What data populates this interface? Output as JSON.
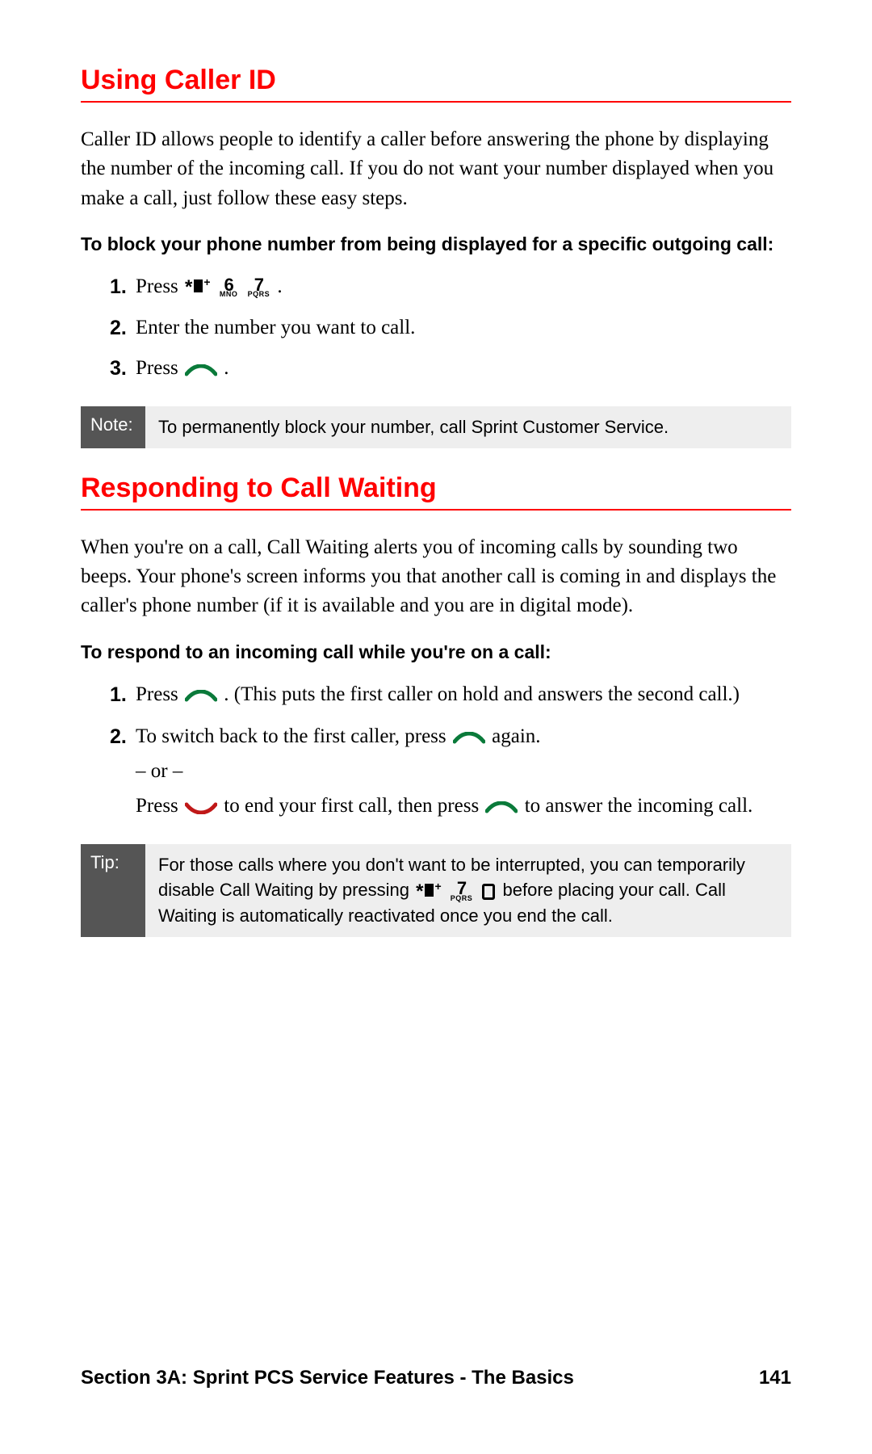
{
  "sections": {
    "caller_id": {
      "heading": "Using Caller ID",
      "intro": "Caller ID allows people to identify a caller before answering the phone by displaying the number of the incoming call. If you do not want your number displayed when you make a call, just follow these easy steps.",
      "sub": "To block your phone number from being displayed for a specific outgoing call:",
      "steps": {
        "s1_pre": "Press ",
        "s1_post": " .",
        "s2": "Enter the number you want to call.",
        "s3_pre": "Press ",
        "s3_post": " ."
      },
      "note_label": "Note:",
      "note_body": "To permanently block your number, call Sprint Customer Service."
    },
    "call_waiting": {
      "heading": "Responding to Call Waiting",
      "intro": "When you're on a call, Call Waiting alerts you of incoming calls by sounding two beeps. Your phone's screen informs you that another call is coming in and displays the caller's phone number (if it is available and you are in digital mode).",
      "sub": "To respond to an incoming call while you're on a call:",
      "steps": {
        "s1_pre": "Press ",
        "s1_post": " . (This puts the first caller on hold and answers the second call.)",
        "s2_pre": "To switch back to the first caller, press ",
        "s2_post": " again.",
        "or": "– or –",
        "s2b_pre": "Press ",
        "s2b_mid": " to end your first call, then press ",
        "s2b_post": " to answer the incoming call."
      },
      "tip_label": "Tip:",
      "tip": {
        "t1": "For those calls where you don't want to be interrupted, you can temporarily disable Call Waiting by pressing ",
        "t2": " before placing your call. Call Waiting is automatically reactivated once you end the call."
      }
    }
  },
  "keys": {
    "six": {
      "digit": "6",
      "letters": "MNO"
    },
    "seven": {
      "digit": "7",
      "letters": "PQRS"
    }
  },
  "footer": {
    "section": "Section 3A: Sprint PCS Service Features - The Basics",
    "page": "141"
  }
}
